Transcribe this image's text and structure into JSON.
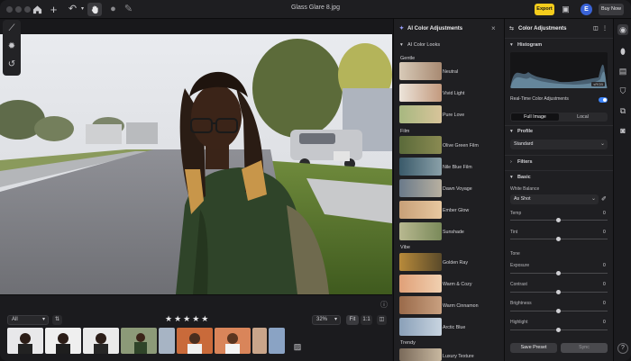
{
  "window": {
    "title": "Glass Glare 8.jpg"
  },
  "toolbar": {
    "export_label": "Export",
    "account_initial": "E",
    "buy_label": "Buy Now"
  },
  "bottom_bar": {
    "filter_value": "All",
    "rating_stars": "★★★★★",
    "zoom_value": "32%",
    "fit_label": "Fit",
    "one_to_one_label": "1:1"
  },
  "looks_panel": {
    "title": "AI Color Adjustments",
    "section_title": "AI Color Looks",
    "groups": [
      {
        "name": "Gentle",
        "items": [
          "Neutral",
          "Vivid Light",
          "Pure Love"
        ]
      },
      {
        "name": "Film",
        "items": [
          "Olive Green Film",
          "Nile Blue Film",
          "Dawn Voyage",
          "Ember Glow",
          "Sunshade"
        ]
      },
      {
        "name": "Vibe",
        "items": [
          "Golden Ray",
          "Warm & Cozy",
          "Warm Cinnamon",
          "Arctic Blue"
        ]
      },
      {
        "name": "Trendy",
        "items": [
          "Luxury Texture"
        ]
      }
    ]
  },
  "adjust_panel": {
    "title": "Color Adjustments",
    "histogram_title": "Histogram",
    "histogram_badge": "sRGB",
    "realtime_label": "Real-Time Color Adjustments",
    "tab_full": "Full Image",
    "tab_local": "Local",
    "profile_title": "Profile",
    "profile_value": "Standard",
    "filters_title": "Filters",
    "basic_title": "Basic",
    "white_balance_label": "White Balance",
    "white_balance_value": "As Shot",
    "temp_label": "Temp",
    "tint_label": "Tint",
    "tone_title": "Tone",
    "sliders": [
      {
        "label": "Exposure",
        "value": 0.5
      },
      {
        "label": "Contrast",
        "value": 0.5
      },
      {
        "label": "Brightness",
        "value": 0.5
      },
      {
        "label": "Highlight",
        "value": 0.5
      }
    ],
    "save_preset_label": "Save Preset",
    "sync_label": "Sync"
  },
  "icons": {
    "home": "home-icon",
    "add": "plus-icon",
    "undo": "undo-icon",
    "hand": "hand-icon",
    "help": "question-icon"
  },
  "colors": {
    "accent": "#f4cc1c",
    "brand_blue": "#3a63d6",
    "toggle": "#3b82f6"
  }
}
